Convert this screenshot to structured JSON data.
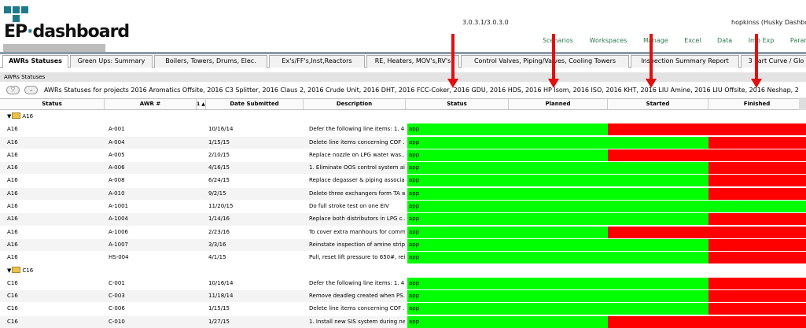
{
  "header": {
    "logo_ep": "EP",
    "logo_dash": "dashboard",
    "version": "3.0.3.1/3.0.3.0",
    "user": "hopkinss (Husky Dashboa",
    "menu": [
      "Scenarios",
      "Workspaces",
      "Manage",
      "Excel",
      "Data",
      "Imp Exp",
      "Paramete"
    ]
  },
  "tabs": [
    "AWRs Statuses",
    "Green Ups: Summary",
    "Boilers, Towers, Drums, Elec.",
    "Ex's/FF's,Inst,Reactors",
    "RE, Heaters, MOV's,RV's",
    "Control Valves, Piping/Valves, Cooling Towers",
    "Inspection Summary Report",
    "3 Part Curve / Glo"
  ],
  "panel_title": "AWRs Statuses",
  "filter_text": "AWRs Statuses for projects 2016 Aromatics Offsite, 2016 C3 Splitter, 2016 Claus 2, 2016 Crude Unit, 2016 DHT, 2016 FCC-Coker, 2016 GDU, 2016 HDS, 2016 HP Isom, 2016 ISO, 2016 KHT, 2016 LIU Amine, 2016 LIU Offsite, 2016 Neshap, 2",
  "columns": [
    "Status",
    "AWR #",
    "1 ▲",
    "Date Submitted",
    "Description",
    "Status",
    "Planned",
    "Started",
    "Finished"
  ],
  "status_label": "app",
  "colors": {
    "green": "#00ff00",
    "red": "#ff0000",
    "arrow": "#e01010"
  },
  "groups": [
    {
      "name": "A16",
      "rows": [
        {
          "status": "A16",
          "awr": "A-001",
          "date": "10/16/14",
          "desc": "Defer the following line items: 1. 4...",
          "p": "g",
          "s": "r",
          "f": "r"
        },
        {
          "status": "A16",
          "awr": "A-004",
          "date": "1/15/15",
          "desc": "Delete line items concerning COF ...",
          "p": "g",
          "s": "g",
          "f": "r"
        },
        {
          "status": "A16",
          "awr": "A-005",
          "date": "2/10/15",
          "desc": "Replace nozzle on LPG water was...",
          "p": "g",
          "s": "r",
          "f": "r"
        },
        {
          "status": "A16",
          "awr": "A-006",
          "date": "4/16/15",
          "desc": "1. Eliminate OOS control system ai...",
          "p": "g",
          "s": "g",
          "f": "r"
        },
        {
          "status": "A16",
          "awr": "A-008",
          "date": "6/24/15",
          "desc": "Replace degasser & piping associa...",
          "p": "g",
          "s": "g",
          "f": "r"
        },
        {
          "status": "A16",
          "awr": "A-010",
          "date": "9/2/15",
          "desc": "Delete three exchangers form TA w...",
          "p": "g",
          "s": "g",
          "f": "r"
        },
        {
          "status": "A16",
          "awr": "A-1001",
          "date": "11/20/15",
          "desc": "Do full stroke test on one EIV",
          "p": "g",
          "s": "g",
          "f": "g"
        },
        {
          "status": "A16",
          "awr": "A-1004",
          "date": "1/14/16",
          "desc": "Replace both distributors in LPG c...",
          "p": "g",
          "s": "g",
          "f": "r"
        },
        {
          "status": "A16",
          "awr": "A-1006",
          "date": "2/23/16",
          "desc": "To cover extra manhours for comm...",
          "p": "g",
          "s": "r",
          "f": "r"
        },
        {
          "status": "A16",
          "awr": "A-1007",
          "date": "3/3/16",
          "desc": "Reinstate inspection of amine strip...",
          "p": "g",
          "s": "g",
          "f": "r"
        },
        {
          "status": "A16",
          "awr": "HS-004",
          "date": "4/1/15",
          "desc": "Pull, reset lift pressure to 650#, rei...",
          "p": "g",
          "s": "g",
          "f": "r"
        }
      ]
    },
    {
      "name": "C16",
      "rows": [
        {
          "status": "C16",
          "awr": "C-001",
          "date": "10/16/14",
          "desc": "Defer the following line items: 1. 4...",
          "p": "g",
          "s": "g",
          "f": "r"
        },
        {
          "status": "C16",
          "awr": "C-003",
          "date": "11/18/14",
          "desc": "Remove deadleg created when PS...",
          "p": "g",
          "s": "g",
          "f": "r"
        },
        {
          "status": "C16",
          "awr": "C-006",
          "date": "1/15/15",
          "desc": "Delete line items concerning COF ...",
          "p": "g",
          "s": "g",
          "f": "r"
        },
        {
          "status": "C16",
          "awr": "C-010",
          "date": "1/27/15",
          "desc": "1. Install new SIS system during ne...",
          "p": "g",
          "s": "r",
          "f": "r"
        }
      ]
    }
  ]
}
